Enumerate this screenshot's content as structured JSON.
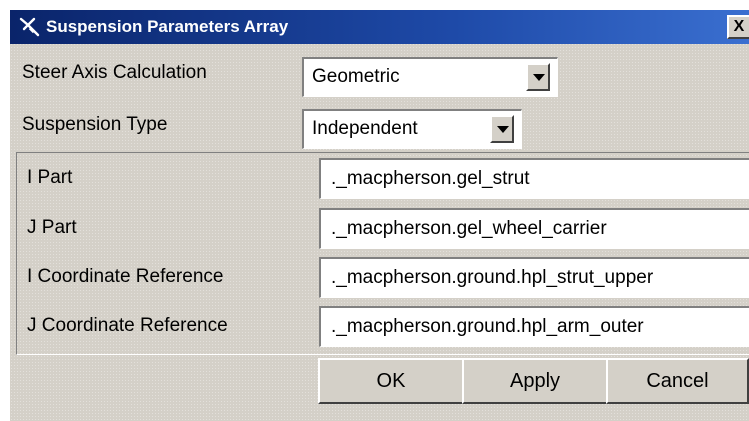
{
  "window": {
    "title": "Suspension Parameters Array",
    "icon": "suspension-app-icon",
    "close_label": "X"
  },
  "steer_axis": {
    "label": "Steer Axis Calculation",
    "value": "Geometric"
  },
  "suspension_type": {
    "label": "Suspension Type",
    "value": "Independent"
  },
  "fields": [
    {
      "label": "I Part",
      "value": "._macpherson.gel_strut"
    },
    {
      "label": "J Part",
      "value": "._macpherson.gel_wheel_carrier"
    },
    {
      "label": "I Coordinate Reference",
      "value": "._macpherson.ground.hpl_strut_upper"
    },
    {
      "label": "J Coordinate Reference",
      "value": "._macpherson.ground.hpl_arm_outer"
    }
  ],
  "buttons": {
    "ok": "OK",
    "apply": "Apply",
    "cancel": "Cancel"
  },
  "colors": {
    "titlebar": "#0a246a",
    "dialog_bg": "#d4d0c8"
  }
}
